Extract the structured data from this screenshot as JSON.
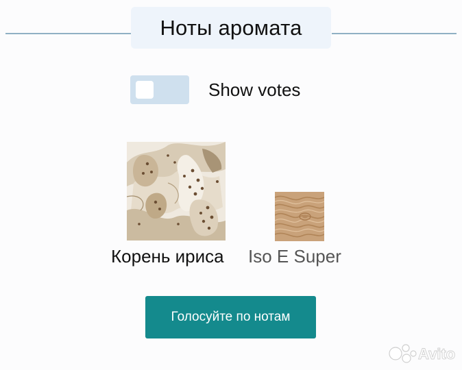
{
  "section": {
    "title": "Ноты аромата"
  },
  "toggle": {
    "label": "Show votes",
    "checked": false
  },
  "notes": [
    {
      "label": "Корень ириса",
      "icon": "orris-root-image"
    },
    {
      "label": "Iso E Super",
      "icon": "wood-grain-image"
    }
  ],
  "vote_button": {
    "label": "Голосуйте по нотам"
  },
  "colors": {
    "accent": "#148a8d",
    "toggle_bg": "#cfe0ee",
    "header_bg": "#eef4fb",
    "divider": "#8fb0c4"
  },
  "watermark": {
    "text": "Avito"
  }
}
